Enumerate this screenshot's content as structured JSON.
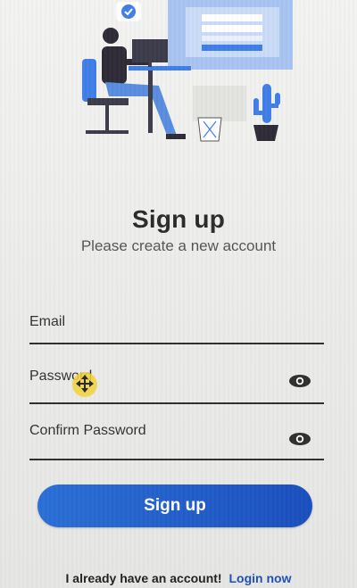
{
  "header": {
    "title": "Sign up",
    "subtitle": "Please create a new account"
  },
  "form": {
    "email_label": "Email",
    "password_label": "Password",
    "confirm_password_label": "Confirm Password",
    "submit_label": "Sign up"
  },
  "footer": {
    "prompt_text": "I already have an account!",
    "login_link": "Login now"
  },
  "illustration": {
    "icon": "person-at-desk-illustration"
  },
  "colors": {
    "accent": "#1a4fbe",
    "link": "#1d4fb5",
    "illustration_blue": "#3f7de8"
  }
}
